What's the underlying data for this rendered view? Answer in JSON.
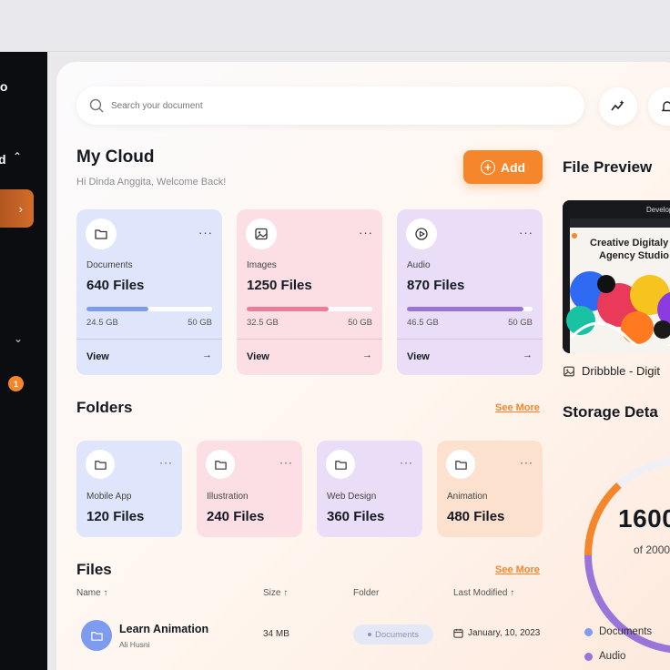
{
  "sidebar": {
    "brand_partial": "io",
    "folded_partial": "d",
    "badge": "1"
  },
  "search": {
    "placeholder": "Search your document"
  },
  "header": {
    "title": "My Cloud",
    "welcome": "Hi Dinda Anggita, Welcome Back!",
    "add_label": "Add"
  },
  "storage_cards": [
    {
      "name": "Documents",
      "count": "640 Files",
      "used": "24.5 GB",
      "total": "50 GB",
      "progress": 0.49,
      "view": "View",
      "color": "#dfe6fb",
      "fill": "#7d9cf0"
    },
    {
      "name": "Images",
      "count": "1250 Files",
      "used": "32.5 GB",
      "total": "50 GB",
      "progress": 0.65,
      "view": "View",
      "color": "#fcdfe5",
      "fill": "#ef7c97"
    },
    {
      "name": "Audio",
      "count": "870 Files",
      "used": "46.5 GB",
      "total": "50 GB",
      "progress": 0.93,
      "view": "View",
      "color": "#e9ddf8",
      "fill": "#9a74d8"
    }
  ],
  "folders": {
    "title": "Folders",
    "see_more": "See More",
    "items": [
      {
        "name": "Mobile App",
        "count": "120 Files",
        "color": "#dfe6fb"
      },
      {
        "name": "Illustration",
        "count": "240 Files",
        "color": "#fcdfe5"
      },
      {
        "name": "Web Design",
        "count": "360 Files",
        "color": "#e9ddf8"
      },
      {
        "name": "Animation",
        "count": "480 Files",
        "color": "#fce1cf"
      }
    ]
  },
  "files": {
    "title": "Files",
    "see_more": "See More",
    "columns": [
      "Name",
      "Size",
      "Folder",
      "Last Modified"
    ],
    "rows": [
      {
        "name": "Learn Animation",
        "owner": "Ali Husni",
        "size": "34 MB",
        "folder": "Documents",
        "date": "January, 10, 2023"
      }
    ]
  },
  "file_preview": {
    "title": "File Preview",
    "image_heading_line1": "Creative Digitaly",
    "image_heading_line2": "Agency Studio",
    "image_nav": "Develop",
    "file_name": "Dribbble - Digit"
  },
  "storage_details": {
    "title": "Storage Deta",
    "total": "1600",
    "sub": "of 2000",
    "legend": [
      {
        "label": "Documents",
        "color": "#7d9cf0"
      },
      {
        "label": "Audio",
        "color": "#9a74d8"
      }
    ]
  },
  "colors": {
    "accent": "#f5862c",
    "sidebar": "#0c0d10"
  }
}
